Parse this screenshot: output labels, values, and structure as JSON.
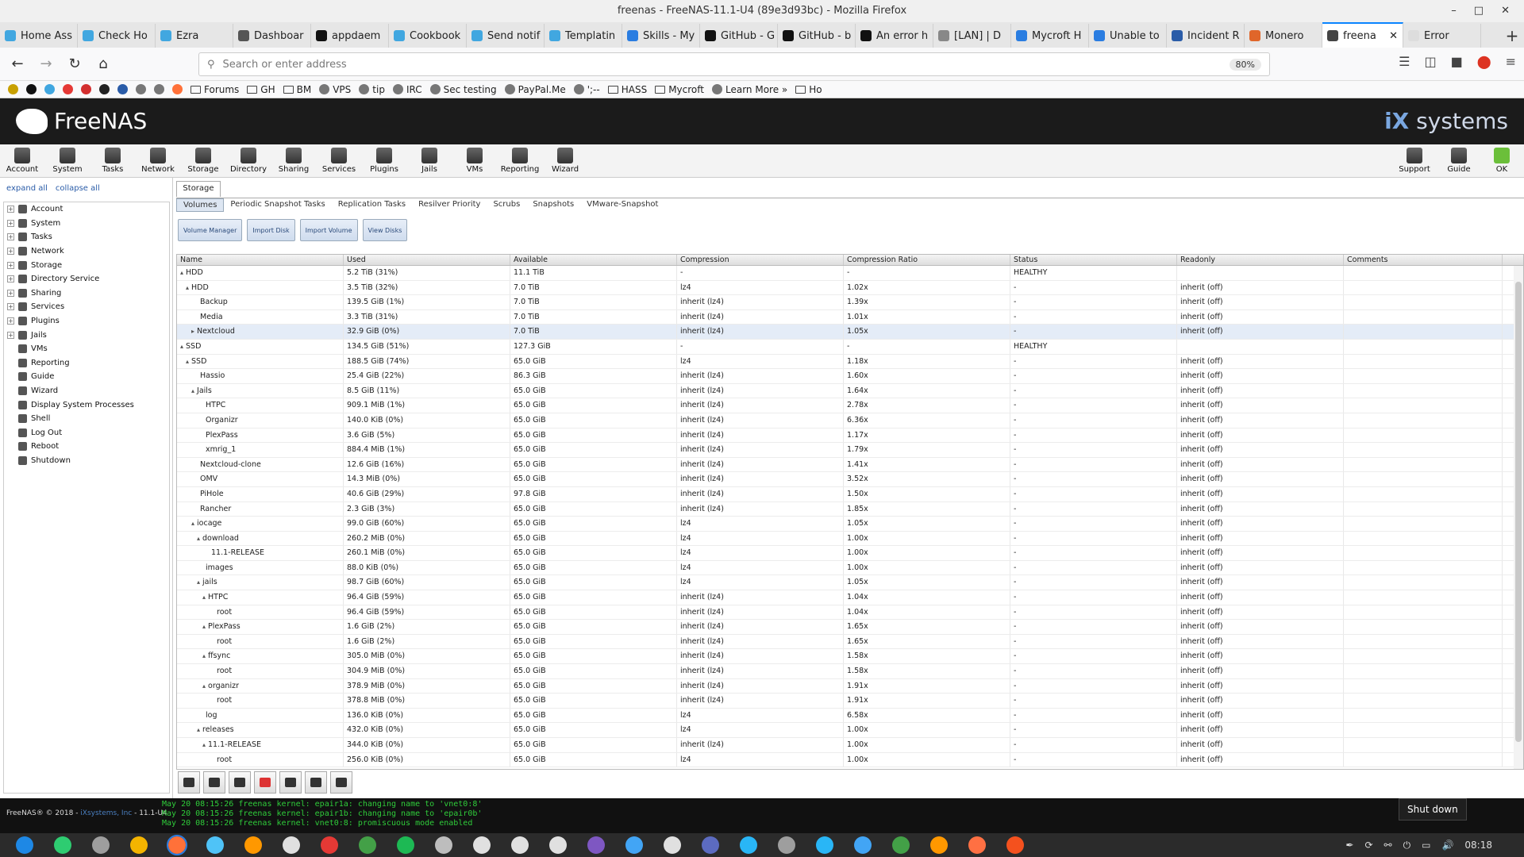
{
  "window": {
    "title": "freenas - FreeNAS-11.1-U4 (89e3d93bc) - Mozilla Firefox",
    "controls": [
      "–",
      "□",
      "✕"
    ]
  },
  "tabs": [
    {
      "label": "Home Ass",
      "color": "#41a7e0"
    },
    {
      "label": "Check Ho",
      "color": "#41a7e0"
    },
    {
      "label": "Ezra",
      "color": "#41a7e0"
    },
    {
      "label": "Dashboar",
      "color": "#555555"
    },
    {
      "label": "appdaem",
      "color": "#111111"
    },
    {
      "label": "Cookbook",
      "color": "#41a7e0"
    },
    {
      "label": "Send notif",
      "color": "#41a7e0"
    },
    {
      "label": "Templatin",
      "color": "#41a7e0"
    },
    {
      "label": "Skills - My",
      "color": "#2a7de1"
    },
    {
      "label": "GitHub - G",
      "color": "#111111"
    },
    {
      "label": "GitHub - b",
      "color": "#111111"
    },
    {
      "label": "An error h",
      "color": "#111111"
    },
    {
      "label": "[LAN] | D",
      "color": "#888888"
    },
    {
      "label": "Mycroft H",
      "color": "#2a7de1"
    },
    {
      "label": "Unable to",
      "color": "#2a7de1"
    },
    {
      "label": "Incident R",
      "color": "#2a5ca8"
    },
    {
      "label": "Monero",
      "color": "#e0662a"
    },
    {
      "label": "freena",
      "color": "#444444",
      "active": true
    },
    {
      "label": "Error",
      "color": "#dddddd"
    }
  ],
  "tab_close": "✕",
  "newtab": "+",
  "nav": {
    "back": "←",
    "forward": "→",
    "reload": "↻",
    "home": "⌂"
  },
  "urlbar": {
    "placeholder": "Search or enter address",
    "zoom": "80%"
  },
  "bookmarks": [
    {
      "type": "folder",
      "label": "Forums"
    },
    {
      "type": "folder",
      "label": "GH"
    },
    {
      "type": "folder",
      "label": "BM"
    },
    {
      "type": "icon",
      "label": "VPS"
    },
    {
      "type": "icon",
      "label": "tip"
    },
    {
      "type": "icon",
      "label": "IRC"
    },
    {
      "type": "icon",
      "label": "Sec testing"
    },
    {
      "type": "icon",
      "label": "PayPal.Me"
    },
    {
      "type": "icon",
      "label": "';--"
    },
    {
      "type": "folder",
      "label": "HASS"
    },
    {
      "type": "folder",
      "label": "Mycroft"
    },
    {
      "type": "icon",
      "label": "Learn More »"
    },
    {
      "type": "folder",
      "label": "Ho"
    }
  ],
  "header": {
    "brand": "FreeNAS",
    "vendor_a": "iX",
    "vendor_b": "systems"
  },
  "toolbar": {
    "left": [
      "Account",
      "System",
      "Tasks",
      "Network",
      "Storage",
      "Directory",
      "Sharing",
      "Services",
      "Plugins",
      "Jails",
      "VMs",
      "Reporting",
      "Wizard"
    ],
    "right": [
      "Support",
      "Guide",
      "OK"
    ]
  },
  "tree": {
    "expand": "expand all",
    "collapse": "collapse all",
    "items": [
      {
        "label": "Account",
        "exp": true
      },
      {
        "label": "System",
        "exp": true
      },
      {
        "label": "Tasks",
        "exp": true
      },
      {
        "label": "Network",
        "exp": true
      },
      {
        "label": "Storage",
        "exp": true
      },
      {
        "label": "Directory Service",
        "exp": true
      },
      {
        "label": "Sharing",
        "exp": true
      },
      {
        "label": "Services",
        "exp": true
      },
      {
        "label": "Plugins",
        "exp": true
      },
      {
        "label": "Jails",
        "exp": true
      },
      {
        "label": "VMs",
        "exp": false
      },
      {
        "label": "Reporting",
        "exp": false
      },
      {
        "label": "Guide",
        "exp": false
      },
      {
        "label": "Wizard",
        "exp": false
      },
      {
        "label": "Display System Processes",
        "exp": false
      },
      {
        "label": "Shell",
        "exp": false
      },
      {
        "label": "Log Out",
        "exp": false
      },
      {
        "label": "Reboot",
        "exp": false
      },
      {
        "label": "Shutdown",
        "exp": false
      }
    ]
  },
  "storage": {
    "tab": "Storage",
    "subtabs": [
      "Volumes",
      "Periodic Snapshot Tasks",
      "Replication Tasks",
      "Resilver Priority",
      "Scrubs",
      "Snapshots",
      "VMware-Snapshot"
    ],
    "actions": [
      "Volume Manager",
      "Import Disk",
      "Import Volume",
      "View Disks"
    ]
  },
  "volumes": {
    "columns": [
      "Name",
      "Used",
      "Available",
      "Compression",
      "Compression Ratio",
      "Status",
      "Readonly",
      "Comments"
    ],
    "rows": [
      {
        "n": "HDD",
        "d": 0,
        "a": "▴",
        "u": "5.2 TiB (31%)",
        "av": "11.1 TiB",
        "c": "-",
        "r": "-",
        "s": "HEALTHY",
        "ro": ""
      },
      {
        "n": "HDD",
        "d": 1,
        "a": "▴",
        "u": "3.5 TiB (32%)",
        "av": "7.0 TiB",
        "c": "lz4",
        "r": "1.02x",
        "s": "-",
        "ro": "inherit (off)"
      },
      {
        "n": "Backup",
        "d": 2,
        "a": "",
        "u": "139.5 GiB (1%)",
        "av": "7.0 TiB",
        "c": "inherit (lz4)",
        "r": "1.39x",
        "s": "-",
        "ro": "inherit (off)"
      },
      {
        "n": "Media",
        "d": 2,
        "a": "",
        "u": "3.3 TiB (31%)",
        "av": "7.0 TiB",
        "c": "inherit (lz4)",
        "r": "1.01x",
        "s": "-",
        "ro": "inherit (off)"
      },
      {
        "n": "Nextcloud",
        "d": 2,
        "a": "▸",
        "u": "32.9 GiB (0%)",
        "av": "7.0 TiB",
        "c": "inherit (lz4)",
        "r": "1.05x",
        "s": "-",
        "ro": "inherit (off)",
        "sel": true
      },
      {
        "n": "SSD",
        "d": 0,
        "a": "▴",
        "u": "134.5 GiB (51%)",
        "av": "127.3 GiB",
        "c": "-",
        "r": "-",
        "s": "HEALTHY",
        "ro": ""
      },
      {
        "n": "SSD",
        "d": 1,
        "a": "▴",
        "u": "188.5 GiB (74%)",
        "av": "65.0 GiB",
        "c": "lz4",
        "r": "1.18x",
        "s": "-",
        "ro": "inherit (off)"
      },
      {
        "n": "Hassio",
        "d": 2,
        "a": "",
        "u": "25.4 GiB (22%)",
        "av": "86.3 GiB",
        "c": "inherit (lz4)",
        "r": "1.60x",
        "s": "-",
        "ro": "inherit (off)"
      },
      {
        "n": "Jails",
        "d": 2,
        "a": "▴",
        "u": "8.5 GiB (11%)",
        "av": "65.0 GiB",
        "c": "inherit (lz4)",
        "r": "1.64x",
        "s": "-",
        "ro": "inherit (off)"
      },
      {
        "n": "HTPC",
        "d": 3,
        "a": "",
        "u": "909.1 MiB (1%)",
        "av": "65.0 GiB",
        "c": "inherit (lz4)",
        "r": "2.78x",
        "s": "-",
        "ro": "inherit (off)"
      },
      {
        "n": "Organizr",
        "d": 3,
        "a": "",
        "u": "140.0 KiB (0%)",
        "av": "65.0 GiB",
        "c": "inherit (lz4)",
        "r": "6.36x",
        "s": "-",
        "ro": "inherit (off)"
      },
      {
        "n": "PlexPass",
        "d": 3,
        "a": "",
        "u": "3.6 GiB (5%)",
        "av": "65.0 GiB",
        "c": "inherit (lz4)",
        "r": "1.17x",
        "s": "-",
        "ro": "inherit (off)"
      },
      {
        "n": "xmrig_1",
        "d": 3,
        "a": "",
        "u": "884.4 MiB (1%)",
        "av": "65.0 GiB",
        "c": "inherit (lz4)",
        "r": "1.79x",
        "s": "-",
        "ro": "inherit (off)"
      },
      {
        "n": "Nextcloud-clone",
        "d": 2,
        "a": "",
        "u": "12.6 GiB (16%)",
        "av": "65.0 GiB",
        "c": "inherit (lz4)",
        "r": "1.41x",
        "s": "-",
        "ro": "inherit (off)"
      },
      {
        "n": "OMV",
        "d": 2,
        "a": "",
        "u": "14.3 MiB (0%)",
        "av": "65.0 GiB",
        "c": "inherit (lz4)",
        "r": "3.52x",
        "s": "-",
        "ro": "inherit (off)"
      },
      {
        "n": "PiHole",
        "d": 2,
        "a": "",
        "u": "40.6 GiB (29%)",
        "av": "97.8 GiB",
        "c": "inherit (lz4)",
        "r": "1.50x",
        "s": "-",
        "ro": "inherit (off)"
      },
      {
        "n": "Rancher",
        "d": 2,
        "a": "",
        "u": "2.3 GiB (3%)",
        "av": "65.0 GiB",
        "c": "inherit (lz4)",
        "r": "1.85x",
        "s": "-",
        "ro": "inherit (off)"
      },
      {
        "n": "iocage",
        "d": 2,
        "a": "▴",
        "u": "99.0 GiB (60%)",
        "av": "65.0 GiB",
        "c": "lz4",
        "r": "1.05x",
        "s": "-",
        "ro": "inherit (off)"
      },
      {
        "n": "download",
        "d": 3,
        "a": "▴",
        "u": "260.2 MiB (0%)",
        "av": "65.0 GiB",
        "c": "lz4",
        "r": "1.00x",
        "s": "-",
        "ro": "inherit (off)"
      },
      {
        "n": "11.1-RELEASE",
        "d": 4,
        "a": "",
        "u": "260.1 MiB (0%)",
        "av": "65.0 GiB",
        "c": "lz4",
        "r": "1.00x",
        "s": "-",
        "ro": "inherit (off)"
      },
      {
        "n": "images",
        "d": 3,
        "a": "",
        "u": "88.0 KiB (0%)",
        "av": "65.0 GiB",
        "c": "lz4",
        "r": "1.00x",
        "s": "-",
        "ro": "inherit (off)"
      },
      {
        "n": "jails",
        "d": 3,
        "a": "▴",
        "u": "98.7 GiB (60%)",
        "av": "65.0 GiB",
        "c": "lz4",
        "r": "1.05x",
        "s": "-",
        "ro": "inherit (off)"
      },
      {
        "n": "HTPC",
        "d": 4,
        "a": "▴",
        "u": "96.4 GiB (59%)",
        "av": "65.0 GiB",
        "c": "inherit (lz4)",
        "r": "1.04x",
        "s": "-",
        "ro": "inherit (off)"
      },
      {
        "n": "root",
        "d": 5,
        "a": "",
        "u": "96.4 GiB (59%)",
        "av": "65.0 GiB",
        "c": "inherit (lz4)",
        "r": "1.04x",
        "s": "-",
        "ro": "inherit (off)"
      },
      {
        "n": "PlexPass",
        "d": 4,
        "a": "▴",
        "u": "1.6 GiB (2%)",
        "av": "65.0 GiB",
        "c": "inherit (lz4)",
        "r": "1.65x",
        "s": "-",
        "ro": "inherit (off)"
      },
      {
        "n": "root",
        "d": 5,
        "a": "",
        "u": "1.6 GiB (2%)",
        "av": "65.0 GiB",
        "c": "inherit (lz4)",
        "r": "1.65x",
        "s": "-",
        "ro": "inherit (off)"
      },
      {
        "n": "ffsync",
        "d": 4,
        "a": "▴",
        "u": "305.0 MiB (0%)",
        "av": "65.0 GiB",
        "c": "inherit (lz4)",
        "r": "1.58x",
        "s": "-",
        "ro": "inherit (off)"
      },
      {
        "n": "root",
        "d": 5,
        "a": "",
        "u": "304.9 MiB (0%)",
        "av": "65.0 GiB",
        "c": "inherit (lz4)",
        "r": "1.58x",
        "s": "-",
        "ro": "inherit (off)"
      },
      {
        "n": "organizr",
        "d": 4,
        "a": "▴",
        "u": "378.9 MiB (0%)",
        "av": "65.0 GiB",
        "c": "inherit (lz4)",
        "r": "1.91x",
        "s": "-",
        "ro": "inherit (off)"
      },
      {
        "n": "root",
        "d": 5,
        "a": "",
        "u": "378.8 MiB (0%)",
        "av": "65.0 GiB",
        "c": "inherit (lz4)",
        "r": "1.91x",
        "s": "-",
        "ro": "inherit (off)"
      },
      {
        "n": "log",
        "d": 3,
        "a": "",
        "u": "136.0 KiB (0%)",
        "av": "65.0 GiB",
        "c": "lz4",
        "r": "6.58x",
        "s": "-",
        "ro": "inherit (off)"
      },
      {
        "n": "releases",
        "d": 3,
        "a": "▴",
        "u": "432.0 KiB (0%)",
        "av": "65.0 GiB",
        "c": "lz4",
        "r": "1.00x",
        "s": "-",
        "ro": "inherit (off)"
      },
      {
        "n": "11.1-RELEASE",
        "d": 4,
        "a": "▴",
        "u": "344.0 KiB (0%)",
        "av": "65.0 GiB",
        "c": "inherit (lz4)",
        "r": "1.00x",
        "s": "-",
        "ro": "inherit (off)"
      },
      {
        "n": "root",
        "d": 5,
        "a": "",
        "u": "256.0 KiB (0%)",
        "av": "65.0 GiB",
        "c": "lz4",
        "r": "1.00x",
        "s": "-",
        "ro": "inherit (off)"
      }
    ]
  },
  "bottom_icons": [
    "import-icon",
    "export-icon",
    "upgrade-icon",
    "destroy-icon",
    "wrench-icon",
    "edit-icon",
    "snapshot-icon"
  ],
  "footer": {
    "copyright": "FreeNAS® © 2018 - ",
    "company": "iXsystems, Inc",
    "version": " - 11.1-U4"
  },
  "console": [
    "May 20 08:15:26 freenas kernel: epair1a: changing name to 'vnet0:8'",
    "May 20 08:15:26 freenas kernel: epair1b: changing name to 'epair0b'",
    "May 20 08:15:26 freenas kernel: vnet0:8: promiscuous mode enabled"
  ],
  "tooltip": "Shut down",
  "taskbar": {
    "clock": "08:18",
    "apps": [
      "#1e88e5",
      "#2ecc71",
      "#9e9e9e",
      "#f4b400",
      "#ff7139",
      "#4fc3f7",
      "#ff9800",
      "#e0e0e0",
      "#e53935",
      "#43a047",
      "#1db954",
      "#bdbdbd",
      "#e0e0e0",
      "#e0e0e0",
      "#e0e0e0",
      "#7e57c2",
      "#42a5f5",
      "#e0e0e0",
      "#5c6bc0",
      "#29b6f6",
      "#9e9e9e",
      "#29b6f6",
      "#42a5f5",
      "#43a047",
      "#ff9800",
      "#ff7043",
      "#f4511e"
    ]
  }
}
